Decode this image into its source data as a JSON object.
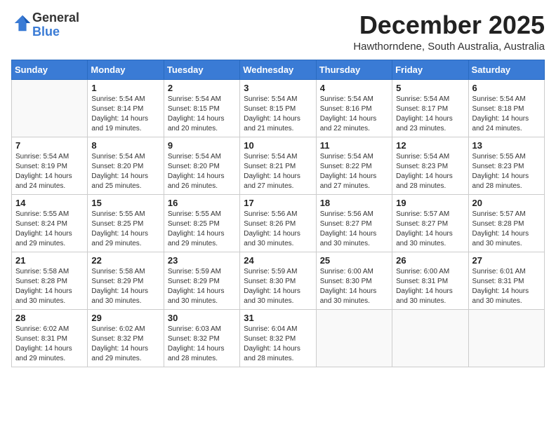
{
  "header": {
    "logo_general": "General",
    "logo_blue": "Blue",
    "month": "December 2025",
    "location": "Hawthorndene, South Australia, Australia"
  },
  "weekdays": [
    "Sunday",
    "Monday",
    "Tuesday",
    "Wednesday",
    "Thursday",
    "Friday",
    "Saturday"
  ],
  "weeks": [
    [
      {
        "day": "",
        "info": ""
      },
      {
        "day": "1",
        "info": "Sunrise: 5:54 AM\nSunset: 8:14 PM\nDaylight: 14 hours\nand 19 minutes."
      },
      {
        "day": "2",
        "info": "Sunrise: 5:54 AM\nSunset: 8:15 PM\nDaylight: 14 hours\nand 20 minutes."
      },
      {
        "day": "3",
        "info": "Sunrise: 5:54 AM\nSunset: 8:15 PM\nDaylight: 14 hours\nand 21 minutes."
      },
      {
        "day": "4",
        "info": "Sunrise: 5:54 AM\nSunset: 8:16 PM\nDaylight: 14 hours\nand 22 minutes."
      },
      {
        "day": "5",
        "info": "Sunrise: 5:54 AM\nSunset: 8:17 PM\nDaylight: 14 hours\nand 23 minutes."
      },
      {
        "day": "6",
        "info": "Sunrise: 5:54 AM\nSunset: 8:18 PM\nDaylight: 14 hours\nand 24 minutes."
      }
    ],
    [
      {
        "day": "7",
        "info": "Sunrise: 5:54 AM\nSunset: 8:19 PM\nDaylight: 14 hours\nand 24 minutes."
      },
      {
        "day": "8",
        "info": "Sunrise: 5:54 AM\nSunset: 8:20 PM\nDaylight: 14 hours\nand 25 minutes."
      },
      {
        "day": "9",
        "info": "Sunrise: 5:54 AM\nSunset: 8:20 PM\nDaylight: 14 hours\nand 26 minutes."
      },
      {
        "day": "10",
        "info": "Sunrise: 5:54 AM\nSunset: 8:21 PM\nDaylight: 14 hours\nand 27 minutes."
      },
      {
        "day": "11",
        "info": "Sunrise: 5:54 AM\nSunset: 8:22 PM\nDaylight: 14 hours\nand 27 minutes."
      },
      {
        "day": "12",
        "info": "Sunrise: 5:54 AM\nSunset: 8:23 PM\nDaylight: 14 hours\nand 28 minutes."
      },
      {
        "day": "13",
        "info": "Sunrise: 5:55 AM\nSunset: 8:23 PM\nDaylight: 14 hours\nand 28 minutes."
      }
    ],
    [
      {
        "day": "14",
        "info": "Sunrise: 5:55 AM\nSunset: 8:24 PM\nDaylight: 14 hours\nand 29 minutes."
      },
      {
        "day": "15",
        "info": "Sunrise: 5:55 AM\nSunset: 8:25 PM\nDaylight: 14 hours\nand 29 minutes."
      },
      {
        "day": "16",
        "info": "Sunrise: 5:55 AM\nSunset: 8:25 PM\nDaylight: 14 hours\nand 29 minutes."
      },
      {
        "day": "17",
        "info": "Sunrise: 5:56 AM\nSunset: 8:26 PM\nDaylight: 14 hours\nand 30 minutes."
      },
      {
        "day": "18",
        "info": "Sunrise: 5:56 AM\nSunset: 8:27 PM\nDaylight: 14 hours\nand 30 minutes."
      },
      {
        "day": "19",
        "info": "Sunrise: 5:57 AM\nSunset: 8:27 PM\nDaylight: 14 hours\nand 30 minutes."
      },
      {
        "day": "20",
        "info": "Sunrise: 5:57 AM\nSunset: 8:28 PM\nDaylight: 14 hours\nand 30 minutes."
      }
    ],
    [
      {
        "day": "21",
        "info": "Sunrise: 5:58 AM\nSunset: 8:28 PM\nDaylight: 14 hours\nand 30 minutes."
      },
      {
        "day": "22",
        "info": "Sunrise: 5:58 AM\nSunset: 8:29 PM\nDaylight: 14 hours\nand 30 minutes."
      },
      {
        "day": "23",
        "info": "Sunrise: 5:59 AM\nSunset: 8:29 PM\nDaylight: 14 hours\nand 30 minutes."
      },
      {
        "day": "24",
        "info": "Sunrise: 5:59 AM\nSunset: 8:30 PM\nDaylight: 14 hours\nand 30 minutes."
      },
      {
        "day": "25",
        "info": "Sunrise: 6:00 AM\nSunset: 8:30 PM\nDaylight: 14 hours\nand 30 minutes."
      },
      {
        "day": "26",
        "info": "Sunrise: 6:00 AM\nSunset: 8:31 PM\nDaylight: 14 hours\nand 30 minutes."
      },
      {
        "day": "27",
        "info": "Sunrise: 6:01 AM\nSunset: 8:31 PM\nDaylight: 14 hours\nand 30 minutes."
      }
    ],
    [
      {
        "day": "28",
        "info": "Sunrise: 6:02 AM\nSunset: 8:31 PM\nDaylight: 14 hours\nand 29 minutes."
      },
      {
        "day": "29",
        "info": "Sunrise: 6:02 AM\nSunset: 8:32 PM\nDaylight: 14 hours\nand 29 minutes."
      },
      {
        "day": "30",
        "info": "Sunrise: 6:03 AM\nSunset: 8:32 PM\nDaylight: 14 hours\nand 28 minutes."
      },
      {
        "day": "31",
        "info": "Sunrise: 6:04 AM\nSunset: 8:32 PM\nDaylight: 14 hours\nand 28 minutes."
      },
      {
        "day": "",
        "info": ""
      },
      {
        "day": "",
        "info": ""
      },
      {
        "day": "",
        "info": ""
      }
    ]
  ]
}
